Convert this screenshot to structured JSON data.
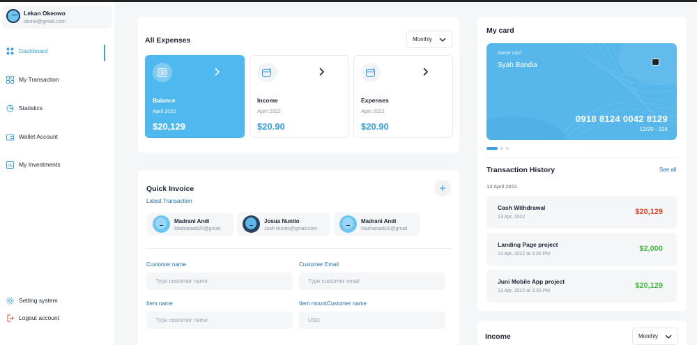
{
  "profile": {
    "name": "Lekan Okeowo",
    "email": "demo@gmail.com"
  },
  "nav": {
    "items": [
      {
        "label": "Dashboard",
        "icon": "grid-icon"
      },
      {
        "label": "My Transaction",
        "icon": "transaction-icon"
      },
      {
        "label": "Statistics",
        "icon": "pie-chart-icon"
      },
      {
        "label": "Wallet Account",
        "icon": "wallet-icon"
      },
      {
        "label": "My Investments",
        "icon": "bar-chart-icon"
      }
    ],
    "bottom": [
      {
        "label": "Setting system",
        "icon": "gear-icon"
      },
      {
        "label": "Logout account",
        "icon": "logout-icon"
      }
    ]
  },
  "expenses": {
    "title": "All Expenses",
    "filter": "Monthly",
    "cards": [
      {
        "label": "Balance",
        "date": "April 2022",
        "value": "$20,129"
      },
      {
        "label": "Income",
        "date": "April 2022",
        "value": "$20.90"
      },
      {
        "label": "Expenses",
        "date": "April 2022",
        "value": "$20.90"
      }
    ]
  },
  "invoice": {
    "title": "Quick Invoice",
    "latest_label": "Latest Transaction",
    "contacts": [
      {
        "name": "Madrani Andi",
        "email": "Madraniadi20@gmail"
      },
      {
        "name": "Josua Nunito",
        "email": "Josh Nunito@gmail.com"
      },
      {
        "name": "Madrani Andi",
        "email": "Madraniadi20@gmail"
      }
    ],
    "fields": {
      "customer_name_label": "Customer name",
      "customer_name_placeholder": "Type customer name",
      "customer_email_label": "Customer Email",
      "customer_email_placeholder": "Type customer email",
      "item_name_label": "Item name",
      "item_name_placeholder": "Type customer name",
      "item_amount_label": "Item mountCustomer name",
      "item_amount_placeholder": "USD"
    }
  },
  "my_card": {
    "title": "My card",
    "name_label": "Name card",
    "holder": "Syah Bandia",
    "number": "0918 8124 0042 8129",
    "expiry": "12/20 - 124",
    "color": "#58b7ea"
  },
  "history": {
    "title": "Transaction History",
    "see_all": "See all",
    "date": "13 April 2022",
    "items": [
      {
        "title": "Cash Withdrawal",
        "date": "13 Apr, 2022",
        "amount": "$20,129",
        "color": "#e0452c"
      },
      {
        "title": "Landing Page project",
        "date": "13 Apr, 2022 at 3:30 PM",
        "amount": "$2,000",
        "color": "#4cbb47"
      },
      {
        "title": "Juni Mobile App project",
        "date": "13 Apr, 2022 at 3:30 PM",
        "amount": "$20,129",
        "color": "#4cbb47"
      }
    ]
  },
  "income": {
    "title": "Income",
    "filter": "Monthly"
  },
  "colors": {
    "accent": "#3aa0e0",
    "negative": "#e0452c",
    "positive": "#4cbb47"
  }
}
